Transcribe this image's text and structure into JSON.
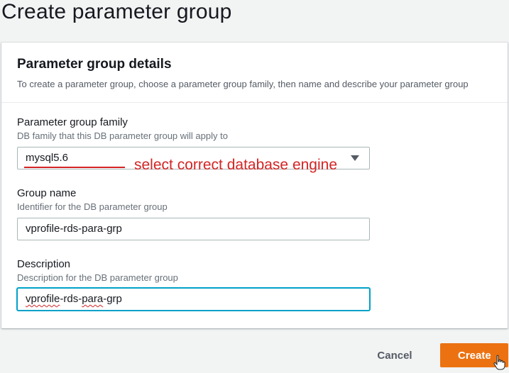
{
  "page": {
    "title": "Create parameter group"
  },
  "panel": {
    "title": "Parameter group details",
    "description": "To create a parameter group, choose a parameter group family, then name and describe your parameter group"
  },
  "family": {
    "label": "Parameter group family",
    "hint": "DB family that this DB parameter group will apply to",
    "value": "mysql5.6"
  },
  "group_name": {
    "label": "Group name",
    "hint": "Identifier for the DB parameter group",
    "value": "vprofile-rds-para-grp"
  },
  "description": {
    "label": "Description",
    "hint": "Description for the DB parameter group",
    "value_part1": "vprofile",
    "value_part2": "-rds-",
    "value_part3": "para",
    "value_part4": "-",
    "value_part5": "grp"
  },
  "annotation": {
    "text": "select correct database engine"
  },
  "actions": {
    "cancel_label": "Cancel",
    "create_label": "Create"
  },
  "colors": {
    "accent": "#ec7211",
    "annotation": "#d42424",
    "focus": "#00a1c9"
  }
}
